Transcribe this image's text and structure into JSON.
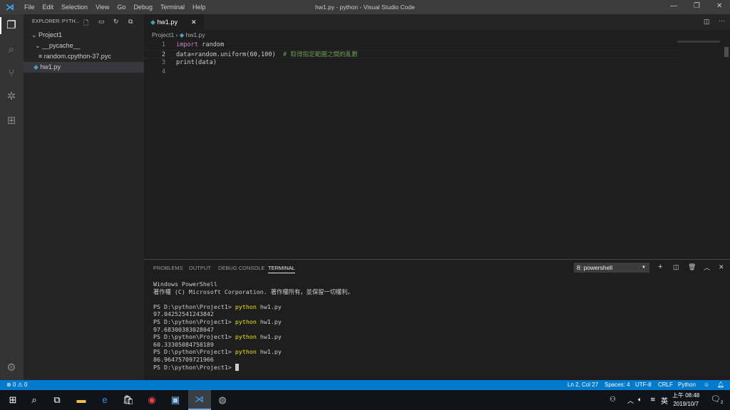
{
  "titlebar": {
    "menu": [
      "File",
      "Edit",
      "Selection",
      "View",
      "Go",
      "Debug",
      "Terminal",
      "Help"
    ],
    "title": "hw1.py - python - Visual Studio Code"
  },
  "sidebar": {
    "header": "EXPLORER: PYTH...",
    "items": [
      {
        "label": "Project1",
        "type": "folder-open"
      },
      {
        "label": "__pycache__",
        "type": "folder-open"
      },
      {
        "label": "random.cpython-37.pyc",
        "type": "file"
      },
      {
        "label": "hw1.py",
        "type": "python",
        "selected": true
      }
    ]
  },
  "editor": {
    "tab": "hw1.py",
    "breadcrumb": [
      "Project1",
      "hw1.py"
    ],
    "lines": [
      {
        "n": "1",
        "kw": "import",
        "rest": " random",
        "comment": ""
      },
      {
        "n": "2",
        "kw": "",
        "rest": "data=random.uniform(60,100)",
        "comment": "  # 取得指定範圍之間的亂數"
      },
      {
        "n": "3",
        "kw": "",
        "rest": "print(data)",
        "comment": ""
      },
      {
        "n": "4",
        "kw": "",
        "rest": "",
        "comment": ""
      }
    ]
  },
  "panel": {
    "tabs": [
      "PROBLEMS",
      "OUTPUT",
      "DEBUG CONSOLE",
      "TERMINAL"
    ],
    "active": "TERMINAL",
    "terminal_select": "8: powershell",
    "lines": [
      {
        "t": "Windows PowerShell",
        "cmd": ""
      },
      {
        "t": "著作權 (C) Microsoft Corporation. 著作權所有，並保留一切權利。",
        "cmd": ""
      },
      {
        "t": "",
        "cmd": ""
      },
      {
        "t": "PS D:\\python\\Project1> ",
        "cmd": "python",
        "arg": " hw1.py"
      },
      {
        "t": "97.04252541243842",
        "cmd": ""
      },
      {
        "t": "PS D:\\python\\Project1> ",
        "cmd": "python",
        "arg": " hw1.py"
      },
      {
        "t": "97.68300383028047",
        "cmd": ""
      },
      {
        "t": "PS D:\\python\\Project1> ",
        "cmd": "python",
        "arg": " hw1.py"
      },
      {
        "t": "60.33305084758189",
        "cmd": ""
      },
      {
        "t": "PS D:\\python\\Project1> ",
        "cmd": "python",
        "arg": " hw1.py"
      },
      {
        "t": "86.96475709721966",
        "cmd": ""
      },
      {
        "t": "PS D:\\python\\Project1> ",
        "cmd": ""
      }
    ]
  },
  "status": {
    "errors": "0",
    "warnings": "0",
    "position": "Ln 2, Col 27",
    "spaces": "Spaces: 4",
    "encoding": "UTF-8",
    "eol": "CRLF",
    "language": "Python"
  },
  "taskbar": {
    "ime": "英",
    "time": "上午 08:48",
    "date": "2019/10/7",
    "notifications": "2"
  },
  "colors": {
    "accent": "#007acc",
    "keyword": "#c586c0",
    "comment": "#6a9955",
    "terminal_command": "#e5e510"
  }
}
